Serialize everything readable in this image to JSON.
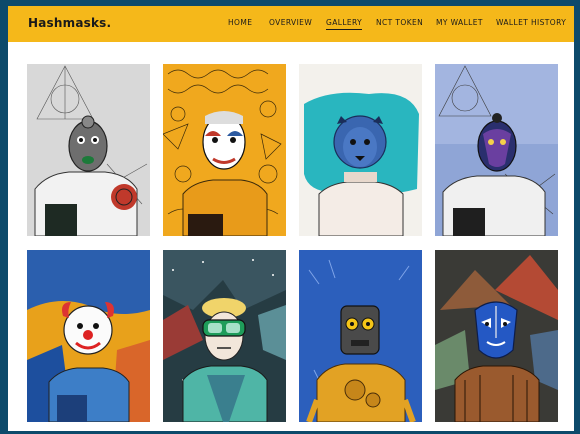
{
  "brand": {
    "name": "Hashmasks."
  },
  "nav": {
    "home": "HOME",
    "overview": "OVERVIEW",
    "gallery": "GALLERY",
    "nct_token": "NCT TOKEN",
    "my_wallet": "MY WALLET",
    "wallet_history": "WALLET HISTORY",
    "active": "GALLERY"
  },
  "colors": {
    "navbar": "#f5b81a",
    "page_frame": "#0d4a6b",
    "content_bg": "#ffffff"
  },
  "gallery": {
    "rows": 2,
    "columns": 4,
    "items": [
      {
        "icon": "hashmask-gray-triangle-icon"
      },
      {
        "icon": "hashmask-yellow-doodle-icon"
      },
      {
        "icon": "hashmask-teal-lion-icon"
      },
      {
        "icon": "hashmask-blue-triangle-icon"
      },
      {
        "icon": "hashmask-clown-icon"
      },
      {
        "icon": "hashmask-diver-icon"
      },
      {
        "icon": "hashmask-robot-icon"
      },
      {
        "icon": "hashmask-blue-tribal-mask-icon"
      }
    ]
  }
}
